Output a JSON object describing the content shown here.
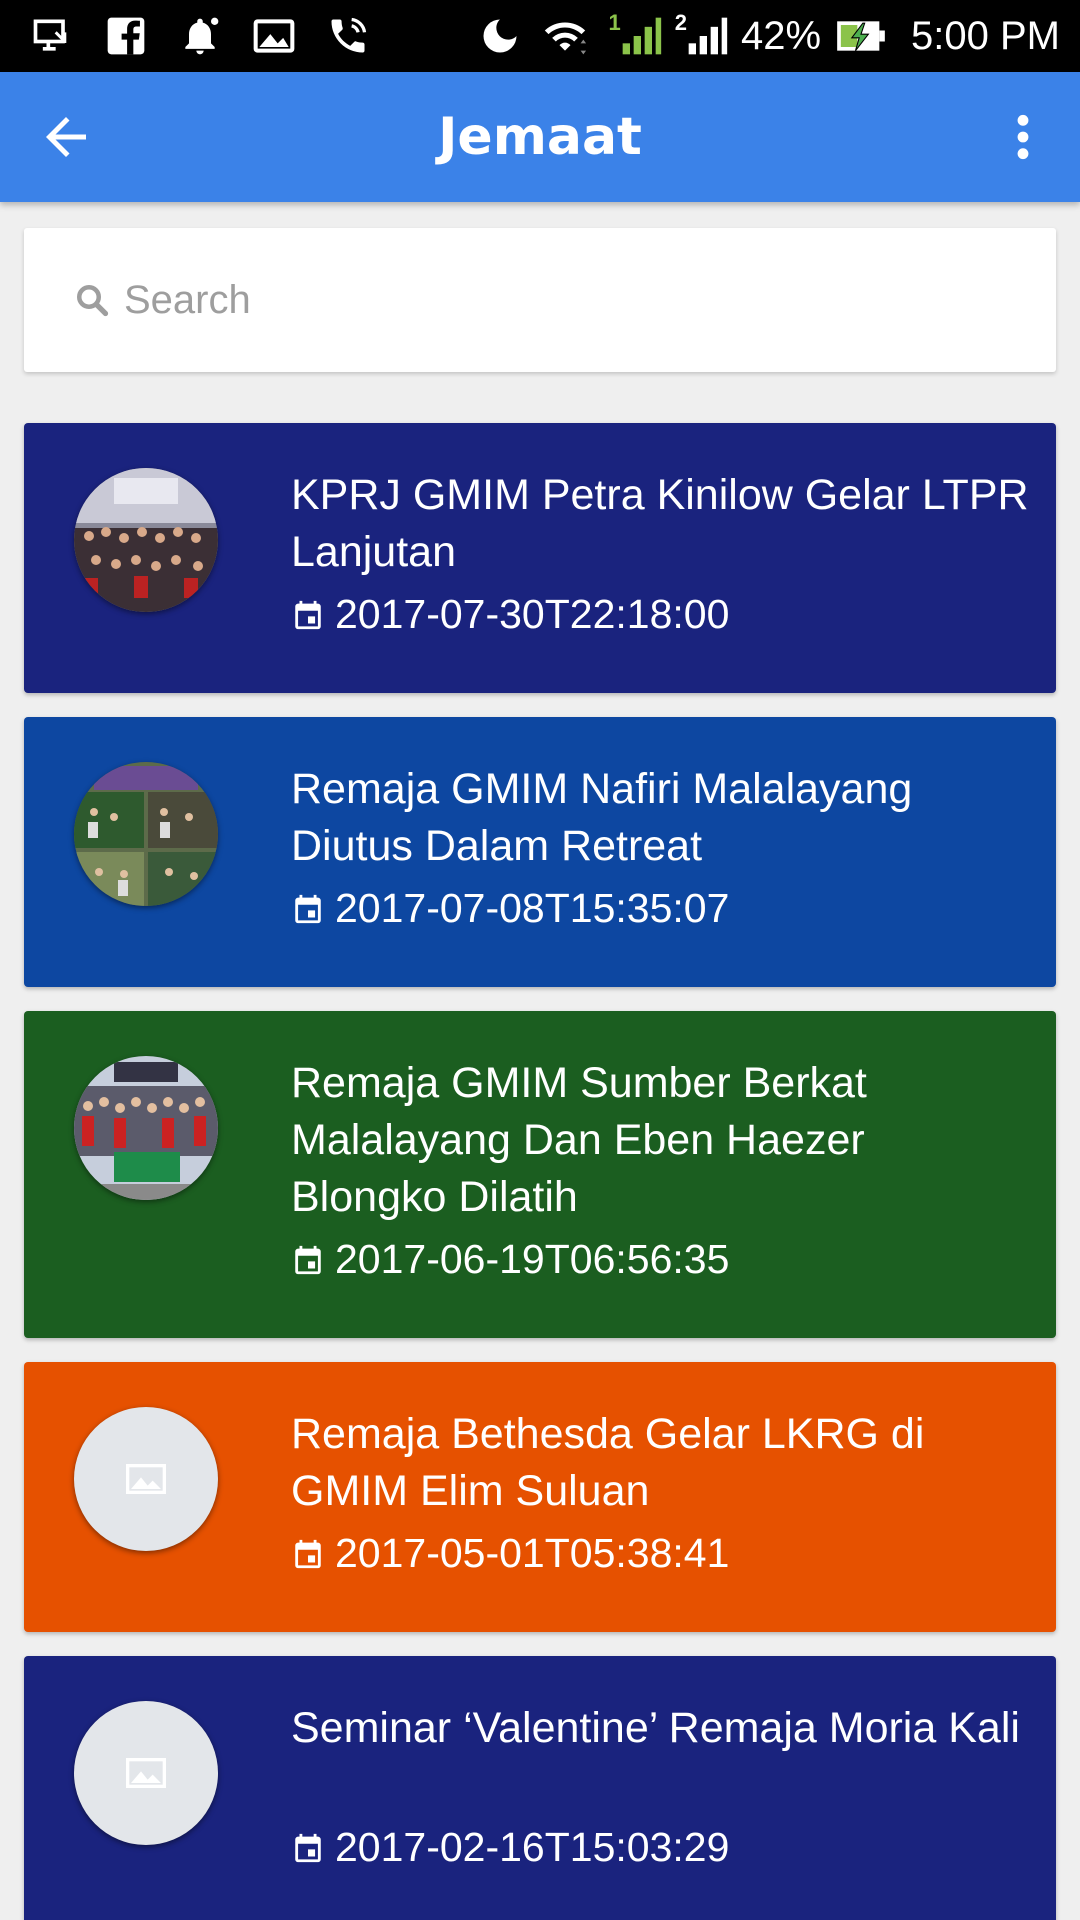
{
  "status_bar": {
    "battery": "42%",
    "time": "5:00 PM",
    "sim1": "1",
    "sim2": "2",
    "icons": [
      "screen-cast-icon",
      "facebook-icon",
      "notification-bell-icon",
      "image-icon",
      "wifi-call-icon",
      "do-not-disturb-moon-icon",
      "wifi-icon",
      "signal-sim1-icon",
      "signal-sim2-icon",
      "battery-charging-icon"
    ]
  },
  "app_bar": {
    "title": "Jemaat",
    "back_icon": "arrow-back-icon",
    "menu_icon": "more-vert-icon",
    "color": "#3b82e8"
  },
  "search": {
    "placeholder": "Search",
    "value": "",
    "icon": "search-icon"
  },
  "posts": [
    {
      "title": "KPRJ GMIM Petra Kinilow Gelar LTPR Lanjutan",
      "date": "2017-07-30T22:18:00",
      "color": "#1a237e",
      "thumbnail": "photo"
    },
    {
      "title": "Remaja GMIM Nafiri Malalayang Diutus Dalam Retreat",
      "date": "2017-07-08T15:35:07",
      "color": "#0d47a1",
      "thumbnail": "photo"
    },
    {
      "title": "Remaja GMIM Sumber Berkat Malalayang Dan Eben Haezer Blongko Dilatih",
      "date": "2017-06-19T06:56:35",
      "color": "#1b5e20",
      "thumbnail": "photo"
    },
    {
      "title": "Remaja Bethesda Gelar LKRG di GMIM Elim Suluan",
      "date": "2017-05-01T05:38:41",
      "color": "#e65100",
      "thumbnail": "placeholder"
    },
    {
      "title": "Seminar ‘Valentine’ Remaja Moria Kali",
      "date": "2017-02-16T15:03:29",
      "color": "#1a237e",
      "thumbnail": "placeholder"
    }
  ]
}
